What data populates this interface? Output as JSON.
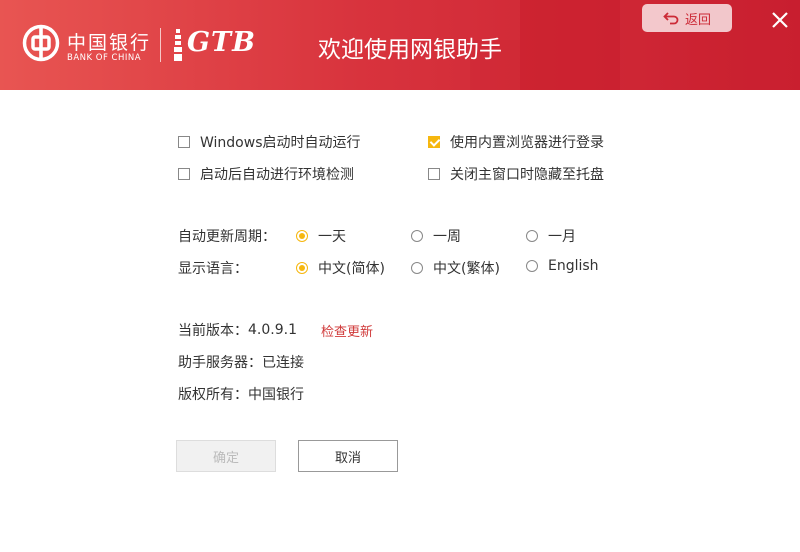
{
  "header": {
    "bank_name_cn": "中国银行",
    "bank_name_en": "BANK OF CHINA",
    "product_logo": "GTB",
    "title": "欢迎使用网银助手",
    "back_label": "返回",
    "back_icon": "return-arrow-icon",
    "close_icon": "close-icon",
    "brand_color": "#d8333d",
    "accent_color": "#f6b70f"
  },
  "options": {
    "startup_auto_run": {
      "label": "Windows启动时自动运行",
      "checked": false
    },
    "use_builtin_browser": {
      "label": "使用内置浏览器进行登录",
      "checked": true
    },
    "auto_env_check": {
      "label": "启动后自动进行环境检测",
      "checked": false
    },
    "hide_to_tray": {
      "label": "关闭主窗口时隐藏至托盘",
      "checked": false
    }
  },
  "update_cycle": {
    "label": "自动更新周期：",
    "options": [
      "一天",
      "一周",
      "一月"
    ],
    "selected": "一天"
  },
  "language": {
    "label": "显示语言：",
    "options": [
      "中文(简体)",
      "中文(繁体)",
      "English"
    ],
    "selected": "中文(简体)"
  },
  "info": {
    "version_label": "当前版本：",
    "version": "4.0.9.1",
    "check_update": "检查更新",
    "server_label": "助手服务器：",
    "server_status": "已连接",
    "copyright_label": "版权所有：",
    "copyright_holder": "中国银行"
  },
  "buttons": {
    "ok": "确定",
    "cancel": "取消"
  }
}
